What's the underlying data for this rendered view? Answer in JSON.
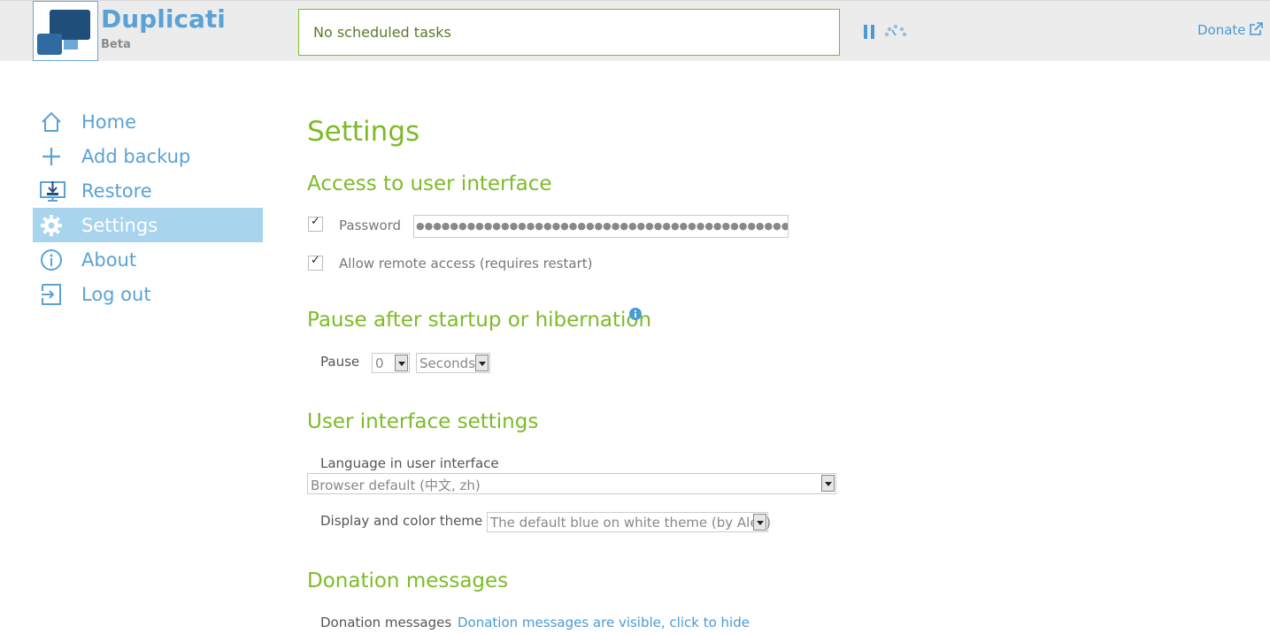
{
  "header": {
    "brand_title": "Duplicati",
    "brand_subtitle": "Beta",
    "status": "No scheduled tasks",
    "donate": "Donate"
  },
  "sidebar": {
    "items": [
      {
        "label": "Home",
        "icon": "home-icon"
      },
      {
        "label": "Add backup",
        "icon": "plus-icon"
      },
      {
        "label": "Restore",
        "icon": "restore-icon"
      },
      {
        "label": "Settings",
        "icon": "gear-icon",
        "active": true
      },
      {
        "label": "About",
        "icon": "info-icon"
      },
      {
        "label": "Log out",
        "icon": "logout-icon"
      }
    ]
  },
  "main": {
    "title": "Settings",
    "access": {
      "heading": "Access to user interface",
      "password_label": "Password",
      "password_value": "●●●●●●●●●●●●●●●●●●●●●●●●●●●●●●●●●●●●●●●●●●●●●●●●●●●●●●●●●",
      "remote_label": "Allow remote access (requires restart)",
      "password_checked": true,
      "remote_checked": true
    },
    "pause": {
      "heading": "Pause after startup or hibernation",
      "label": "Pause",
      "amount": "0",
      "unit": "Seconds"
    },
    "ui_settings": {
      "heading": "User interface settings",
      "language_label": "Language in user interface",
      "language_value": "Browser default (中文, zh)",
      "theme_label": "Display and color theme",
      "theme_value": "The default blue on white theme (by Alex)"
    },
    "donation": {
      "heading": "Donation messages",
      "label": "Donation messages",
      "link": "Donation messages are visible, click to hide"
    }
  },
  "colors": {
    "accent_green": "#7dbb28",
    "accent_blue": "#5aa2d6",
    "active_bg": "#a8d4ee"
  }
}
